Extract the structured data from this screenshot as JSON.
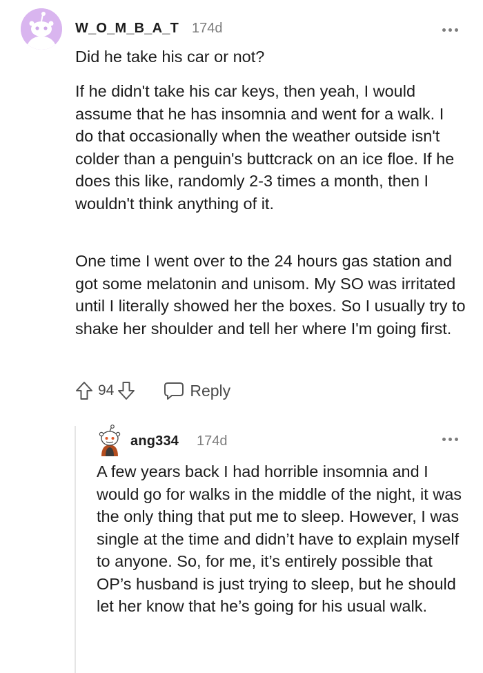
{
  "comment": {
    "username": "W_O_M_B_A_T",
    "age": "174d",
    "paragraphs": [
      "Did he take his car or not?",
      "If he didn't take his car keys, then yeah, I would assume that he has insomnia and went for a walk. I do that occasionally when the weather outside isn't colder than a penguin's buttcrack on an ice floe. If he does this like, randomly 2-3 times a month, then I wouldn't think anything of it.",
      "One time I went over to the 24 hours gas station and got some melatonin and unisom. My SO was irritated until I literally showed her the boxes. So I usually try to shake her shoulder and tell her where I'm going first."
    ],
    "vote_count": "94",
    "reply_label": "Reply",
    "avatar_bg": "#d9b5ef"
  },
  "reply": {
    "username": "ang334",
    "age": "174d",
    "paragraphs": [
      "A few years back I had horrible insomnia and I would go for walks in the middle of the night, it was the only thing that put me to sleep. However, I was single at the time and didn’t have to explain myself to anyone. So, for me, it’s entirely possible that OP’s husband is just trying to sleep, but he should let her know that he’s going for his usual walk."
    ]
  },
  "icons": {
    "upvote": "arrow-up-outline",
    "downvote": "arrow-down-outline",
    "reply": "speech-bubble",
    "more": "three-dots"
  }
}
